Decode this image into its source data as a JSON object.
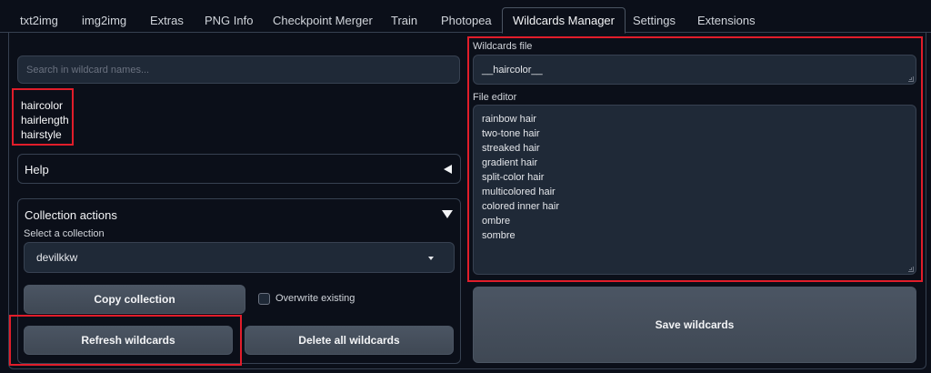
{
  "tabs": [
    {
      "label": "txt2img"
    },
    {
      "label": "img2img"
    },
    {
      "label": "Extras"
    },
    {
      "label": "PNG Info"
    },
    {
      "label": "Checkpoint Merger"
    },
    {
      "label": "Train"
    },
    {
      "label": "Photopea"
    },
    {
      "label": "Wildcards Manager",
      "active": true
    },
    {
      "label": "Settings"
    },
    {
      "label": "Extensions"
    }
  ],
  "left": {
    "search_placeholder": "Search in wildcard names...",
    "wildcards": [
      "haircolor",
      "hairlength",
      "hairstyle"
    ],
    "help_title": "Help",
    "collection": {
      "title": "Collection actions",
      "select_label": "Select a collection",
      "selected": "devilkkw",
      "copy_label": "Copy collection",
      "overwrite_label": "Overwrite existing",
      "overwrite_checked": false,
      "refresh_label": "Refresh wildcards",
      "delete_label": "Delete all wildcards"
    }
  },
  "right": {
    "file_label": "Wildcards file",
    "file_value": "__haircolor__",
    "editor_label": "File editor",
    "editor_lines": [
      "rainbow hair",
      "two-tone hair",
      "streaked hair",
      "gradient hair",
      "split-color hair",
      "multicolored hair",
      "colored inner hair",
      "ombre",
      "sombre"
    ],
    "save_label": "Save wildcards"
  },
  "colors": {
    "background": "#0b0f19",
    "input": "#1f2937",
    "button": "#4b5563",
    "highlight": "#e11d2a"
  },
  "icons": {
    "help_toggle": "triangle-left-icon",
    "collection_toggle": "triangle-down-icon",
    "select_caret": "chevron-down-icon"
  }
}
